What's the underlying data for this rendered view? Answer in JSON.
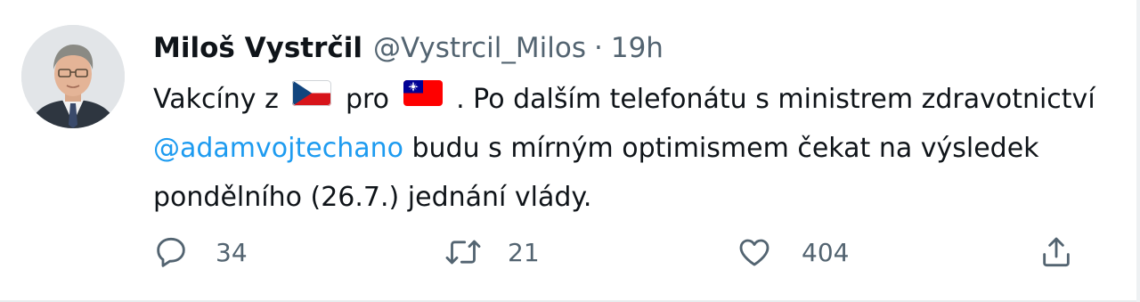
{
  "tweet": {
    "author": {
      "name": "Miloš Vystrčil",
      "handle": "@Vystrcil_Milos",
      "separator": "·",
      "time": "19h"
    },
    "text": {
      "line1": {
        "before_flag1": "Vakcíny z",
        "flag1": "czech-flag",
        "between_flags": "pro",
        "flag2": "taiwan-flag",
        "after_flag2": ". Po dalším telefonátu s ministrem zdravotnictví"
      },
      "line2": {
        "mention": "@adamvojtechano",
        "rest": " budu s mírným optimismem čekat na výsledek"
      },
      "line3": "pondělního (26.7.) jednání vlády."
    },
    "actions": {
      "reply": {
        "icon": "reply-icon",
        "count": "34"
      },
      "retweet": {
        "icon": "retweet-icon",
        "count": "21"
      },
      "like": {
        "icon": "heart-icon",
        "count": "404"
      },
      "share": {
        "icon": "share-icon"
      }
    },
    "colors": {
      "text": "#0f1419",
      "secondary": "#536471",
      "link": "#1d9bf0"
    }
  }
}
